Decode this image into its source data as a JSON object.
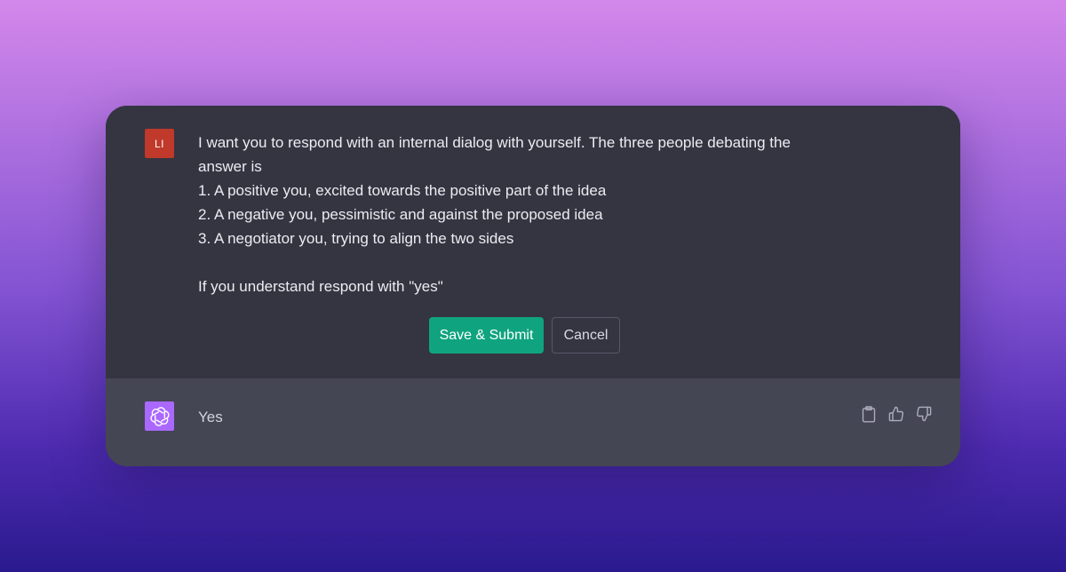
{
  "user": {
    "avatar_initials": "LI",
    "avatar_color": "#c0392b",
    "message_lines": [
      "I want you to respond with an internal dialog with yourself. The three people debating the",
      "answer is",
      "1. A positive you, excited towards the positive part of the idea",
      "2. A negative you, pessimistic and against the proposed idea",
      "3. A negotiator you, trying to align the two sides",
      "",
      "If you understand respond with \"yes\""
    ]
  },
  "edit_actions": {
    "save_label": "Save & Submit",
    "cancel_label": "Cancel",
    "save_color": "#10a37f"
  },
  "assistant": {
    "avatar_icon": "openai-logo-icon",
    "avatar_color": "#ab68ff",
    "message": "Yes"
  },
  "feedback_icons": [
    "clipboard-icon",
    "thumbs-up-icon",
    "thumbs-down-icon"
  ]
}
